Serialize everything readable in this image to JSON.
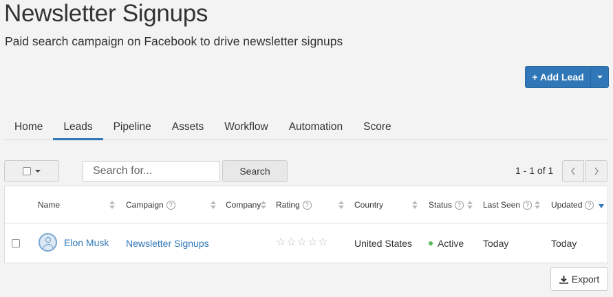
{
  "header": {
    "title": "Newsletter Signups",
    "subtitle": "Paid search campaign on Facebook to drive newsletter signups"
  },
  "actions": {
    "add_lead_label": "+ Add Lead"
  },
  "tabs": [
    {
      "label": "Home",
      "active": false
    },
    {
      "label": "Leads",
      "active": true
    },
    {
      "label": "Pipeline",
      "active": false
    },
    {
      "label": "Assets",
      "active": false
    },
    {
      "label": "Workflow",
      "active": false
    },
    {
      "label": "Automation",
      "active": false
    },
    {
      "label": "Score",
      "active": false
    }
  ],
  "toolbar": {
    "search_placeholder": "Search for...",
    "search_button": "Search",
    "pager_text": "1 - 1 of 1",
    "prev_icon": "chevron-left-icon",
    "next_icon": "chevron-right-icon"
  },
  "table": {
    "columns": [
      "Name",
      "Campaign",
      "Company",
      "Rating",
      "Country",
      "Status",
      "Last Seen",
      "Updated"
    ],
    "rows": [
      {
        "name": "Elon Musk",
        "campaign": "Newsletter Signups",
        "company": "",
        "rating": 0,
        "country": "United States",
        "status": "Active",
        "last_seen": "Today",
        "updated": "Today"
      }
    ]
  },
  "footer": {
    "export_label": "Export"
  },
  "colors": {
    "accent": "#2f77b6",
    "status_active": "#5cb85c"
  }
}
